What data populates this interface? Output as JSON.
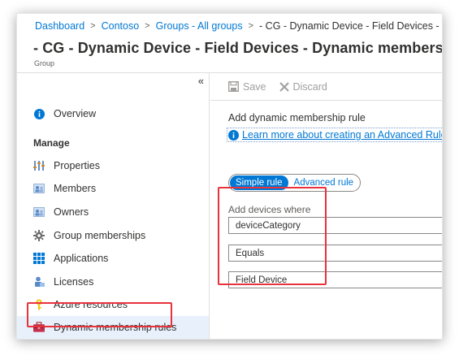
{
  "breadcrumb": {
    "items": [
      "Dashboard",
      "Contoso",
      "Groups - All groups"
    ],
    "current": "- CG - Dynamic Device - Field Devices - Dynami"
  },
  "page": {
    "title": "- CG - Dynamic Device - Field Devices - Dynamic membership rules",
    "subtitle": "Group"
  },
  "sidebar": {
    "collapse_glyph": "«",
    "overview": "Overview",
    "section": "Manage",
    "items": [
      {
        "label": "Properties",
        "icon": "properties-icon"
      },
      {
        "label": "Members",
        "icon": "members-icon"
      },
      {
        "label": "Owners",
        "icon": "owners-icon"
      },
      {
        "label": "Group memberships",
        "icon": "gear-icon"
      },
      {
        "label": "Applications",
        "icon": "applications-grid-icon"
      },
      {
        "label": "Licenses",
        "icon": "licenses-icon"
      },
      {
        "label": "Azure resources",
        "icon": "key-icon"
      },
      {
        "label": "Dynamic membership rules",
        "icon": "toolbox-icon"
      }
    ]
  },
  "toolbar": {
    "save_label": "Save",
    "discard_label": "Discard"
  },
  "content": {
    "heading": "Add dynamic membership rule",
    "learn_more": "Learn more about creating an Advanced Rule",
    "toggle": {
      "simple": "Simple rule",
      "advanced": "Advanced rule",
      "selected": "simple"
    },
    "field_label": "Add devices where",
    "fields": {
      "property": "deviceCategory",
      "operator": "Equals",
      "value": "Field Device"
    }
  },
  "colors": {
    "accent": "#0078d4",
    "highlight": "#e8323c"
  }
}
